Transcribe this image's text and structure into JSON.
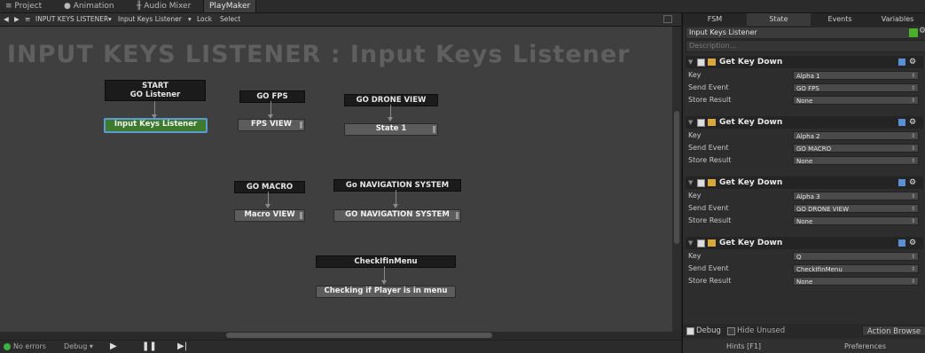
{
  "tabs": [
    {
      "label": "Project",
      "icon": "project-icon"
    },
    {
      "label": "Animation",
      "icon": "animation-icon"
    },
    {
      "label": "Audio Mixer",
      "icon": "mixer-icon"
    },
    {
      "label": "PlayMaker",
      "icon": "none"
    }
  ],
  "breadcrumb": {
    "fsm": "INPUT KEYS LISTENER",
    "state": "Input Keys Listener",
    "lock": "Lock",
    "select": "Select"
  },
  "canvas": {
    "title": "INPUT KEYS LISTENER : Input Keys Listener",
    "start_label": "START",
    "nodes": {
      "start": {
        "event": "GO Listener",
        "state": "Input Keys Listener"
      },
      "fps": {
        "event": "GO FPS",
        "state": "FPS VIEW"
      },
      "drone": {
        "event": "GO DRONE VIEW",
        "state": "State 1"
      },
      "macro": {
        "event": "GO MACRO",
        "state": "Macro VIEW"
      },
      "nav": {
        "event": "Go NAVIGATION SYSTEM",
        "state": "GO NAVIGATION SYSTEM"
      },
      "menu": {
        "event": "CheckIfInMenu",
        "state": "Checking if Player is in menu"
      }
    }
  },
  "status": {
    "errors": "No errors",
    "debug": "Debug",
    "play_icon": "play-icon",
    "pause_icon": "pause-icon",
    "step_icon": "step-icon"
  },
  "inspector": {
    "tabs": [
      "FSM",
      "State",
      "Events",
      "Variables"
    ],
    "active_tab": "State",
    "state_name": "Input Keys Listener",
    "description_placeholder": "Description...",
    "actions": [
      {
        "title": "Get Key Down",
        "key_label": "Key",
        "key": "Alpha 1",
        "event_label": "Send Event",
        "event": "GO FPS",
        "result_label": "Store Result",
        "result": "None"
      },
      {
        "title": "Get Key Down",
        "key_label": "Key",
        "key": "Alpha 2",
        "event_label": "Send Event",
        "event": "GO MACRO",
        "result_label": "Store Result",
        "result": "None"
      },
      {
        "title": "Get Key Down",
        "key_label": "Key",
        "key": "Alpha 3",
        "event_label": "Send Event",
        "event": "GO DRONE VIEW",
        "result_label": "Store Result",
        "result": "None"
      },
      {
        "title": "Get Key Down",
        "key_label": "Key",
        "key": "Q",
        "event_label": "Send Event",
        "event": "CheckIfInMenu",
        "result_label": "Store Result",
        "result": "None"
      }
    ],
    "debug_label": "Debug",
    "hide_unused_label": "Hide Unused",
    "action_browser_label": "Action Browse",
    "hints_label": "Hints [F1]",
    "preferences_label": "Preferences"
  },
  "colors": {
    "accent_green": "#4caf2a",
    "selected_border": "#5b9bd5",
    "canvas_bg": "#3f3f3f"
  }
}
